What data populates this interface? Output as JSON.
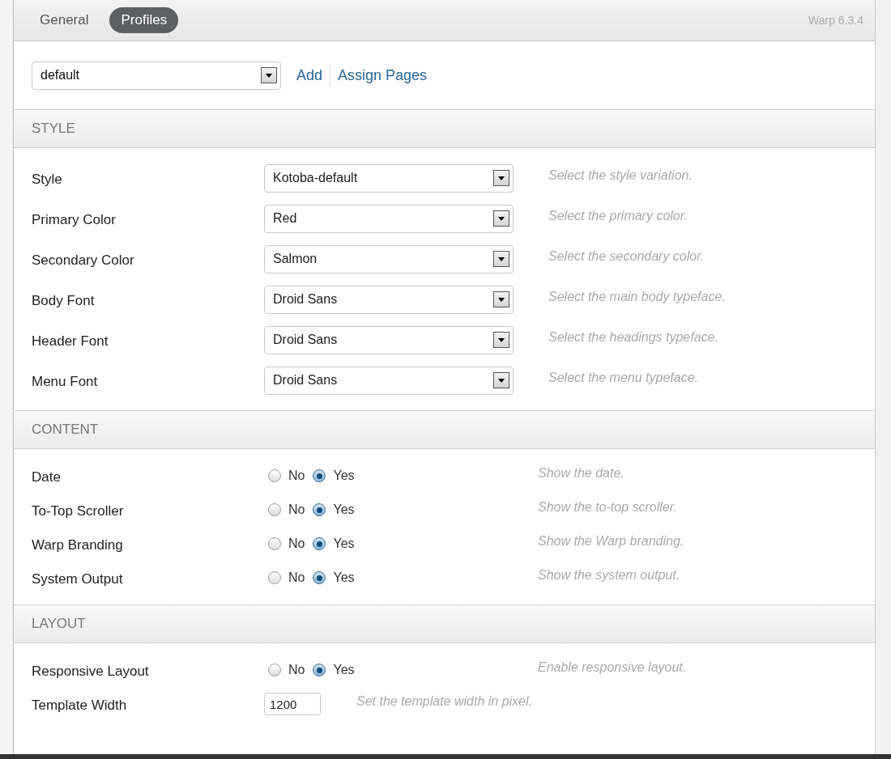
{
  "tabs": [
    {
      "label": "General",
      "selected": false
    },
    {
      "label": "Profiles",
      "selected": true
    }
  ],
  "version": "Warp 6.3.4",
  "profile": {
    "value": "default",
    "links": [
      "Add",
      "Assign Pages"
    ]
  },
  "sections": [
    {
      "title": "STYLE",
      "rows": [
        {
          "kind": "select",
          "label": "Style",
          "value": "Kotoba-default",
          "hint": "Select the style variation."
        },
        {
          "kind": "select",
          "label": "Primary Color",
          "value": "Red",
          "hint": "Select the primary color."
        },
        {
          "kind": "select",
          "label": "Secondary Color",
          "value": "Salmon",
          "hint": "Select the secondary color."
        },
        {
          "kind": "select",
          "label": "Body Font",
          "value": "Droid Sans",
          "hint": "Select the main body typeface."
        },
        {
          "kind": "select",
          "label": "Header Font",
          "value": "Droid Sans",
          "hint": "Select the headings typeface."
        },
        {
          "kind": "select",
          "label": "Menu Font",
          "value": "Droid Sans",
          "hint": "Select the menu typeface."
        }
      ]
    },
    {
      "title": "CONTENT",
      "rows": [
        {
          "kind": "radio",
          "label": "Date",
          "options": [
            {
              "label": "No",
              "selected": false
            },
            {
              "label": "Yes",
              "selected": true
            }
          ],
          "hint": "Show the date."
        },
        {
          "kind": "radio",
          "label": "To-Top Scroller",
          "options": [
            {
              "label": "No",
              "selected": false
            },
            {
              "label": "Yes",
              "selected": true
            }
          ],
          "hint": "Show the to-top scroller."
        },
        {
          "kind": "radio",
          "label": "Warp Branding",
          "options": [
            {
              "label": "No",
              "selected": false
            },
            {
              "label": "Yes",
              "selected": true
            }
          ],
          "hint": "Show the Warp branding."
        },
        {
          "kind": "radio",
          "label": "System Output",
          "options": [
            {
              "label": "No",
              "selected": false
            },
            {
              "label": "Yes",
              "selected": true
            }
          ],
          "hint": "Show the system output."
        }
      ]
    },
    {
      "title": "LAYOUT",
      "rows": [
        {
          "kind": "radio",
          "label": "Responsive Layout",
          "options": [
            {
              "label": "No",
              "selected": false
            },
            {
              "label": "Yes",
              "selected": true
            }
          ],
          "hint": "Enable responsive layout."
        },
        {
          "kind": "text",
          "label": "Template Width",
          "value": "1200",
          "hint": "Set the template width in pixel."
        }
      ]
    }
  ]
}
